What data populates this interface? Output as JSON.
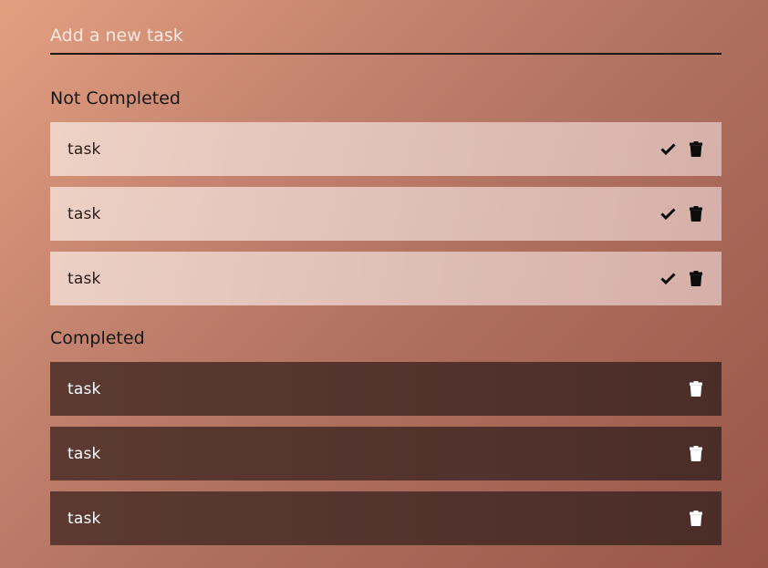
{
  "new_task_input": {
    "placeholder": "Add a new task",
    "value": ""
  },
  "sections": {
    "not_completed": {
      "title": "Not Completed",
      "tasks": [
        {
          "text": "task"
        },
        {
          "text": "task"
        },
        {
          "text": "task"
        }
      ],
      "icons": [
        "check-icon",
        "trash-icon"
      ]
    },
    "completed": {
      "title": "Completed",
      "tasks": [
        {
          "text": "task"
        },
        {
          "text": "task"
        },
        {
          "text": "task"
        }
      ],
      "icons": [
        "trash-icon"
      ]
    }
  },
  "colors": {
    "background_start": "#e39f80",
    "background_end": "#985548",
    "pending_item": "#ead0c7",
    "completed_item": "#543530",
    "input_underline": "#1a1a1a"
  }
}
